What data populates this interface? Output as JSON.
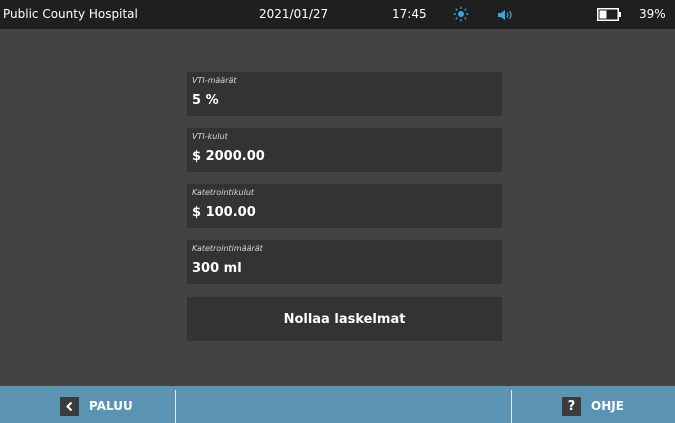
{
  "status_bar": {
    "facility": "Public County Hospital",
    "date": "2021/01/27",
    "time": "17:45",
    "battery_percent": "39%",
    "brightness_icon": "sun-icon",
    "volume_icon": "speaker-icon",
    "battery_icon": "battery-icon",
    "accent_color": "#3aa6e0"
  },
  "fields": [
    {
      "label": "VTI-määrät",
      "value": "5 %"
    },
    {
      "label": "VTI-kulut",
      "value": "$ 2000.00"
    },
    {
      "label": "Katetrointikulut",
      "value": "$ 100.00"
    },
    {
      "label": "Katetrointimäärät",
      "value": "300 ml"
    }
  ],
  "reset_button": {
    "label": "Nollaa laskelmat"
  },
  "nav": {
    "back_label": "PALUU",
    "back_icon": "chevron-left-icon",
    "help_label": "OHJE",
    "help_icon": "question-icon",
    "bar_color": "#5a94b2"
  }
}
